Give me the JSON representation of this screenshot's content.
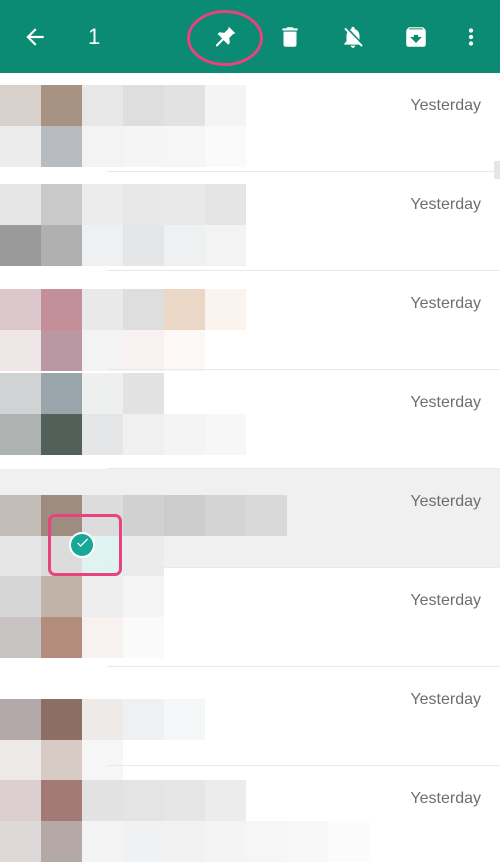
{
  "toolbar": {
    "background": "#0b8a74",
    "selected_count": "1",
    "actions": [
      {
        "name": "back-button",
        "icon": "arrow-left-icon"
      },
      {
        "name": "pin-button",
        "icon": "pin-icon"
      },
      {
        "name": "delete-button",
        "icon": "trash-icon"
      },
      {
        "name": "mute-button",
        "icon": "mute-icon"
      },
      {
        "name": "archive-button",
        "icon": "archive-icon"
      },
      {
        "name": "more-options-button",
        "icon": "more-vert-icon"
      }
    ]
  },
  "annotations": {
    "color": "#e7437e",
    "highlighted": [
      "pin-button",
      "selected-check-badge"
    ]
  },
  "chats": [
    {
      "time": "Yesterday",
      "selected": false
    },
    {
      "time": "Yesterday",
      "selected": false
    },
    {
      "time": "Yesterday",
      "selected": false
    },
    {
      "time": "Yesterday",
      "selected": false
    },
    {
      "time": "Yesterday",
      "selected": true
    },
    {
      "time": "Yesterday",
      "selected": false
    },
    {
      "time": "Yesterday",
      "selected": false
    },
    {
      "time": "Yesterday",
      "selected": false
    }
  ]
}
